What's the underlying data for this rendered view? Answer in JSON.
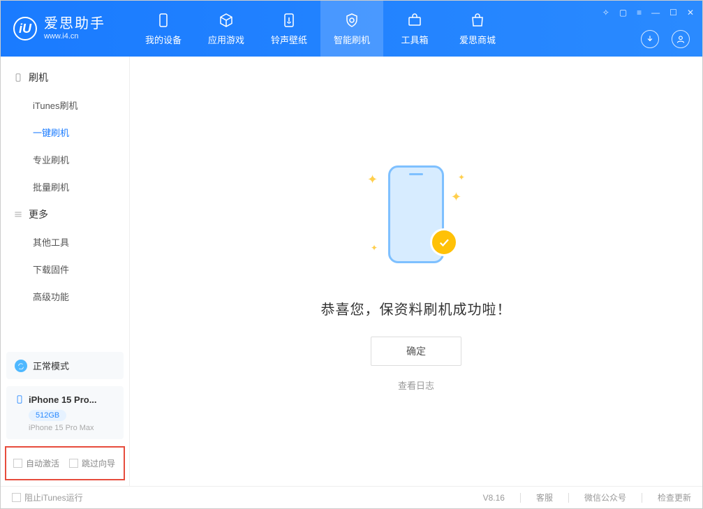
{
  "brand": {
    "title": "爱思助手",
    "subtitle": "www.i4.cn",
    "logo_letter": "iU"
  },
  "nav": {
    "items": [
      {
        "label": "我的设备"
      },
      {
        "label": "应用游戏"
      },
      {
        "label": "铃声壁纸"
      },
      {
        "label": "智能刷机"
      },
      {
        "label": "工具箱"
      },
      {
        "label": "爱思商城"
      }
    ],
    "active_index": 3
  },
  "sidebar": {
    "group_flash": "刷机",
    "items_flash": [
      {
        "label": "iTunes刷机"
      },
      {
        "label": "一键刷机"
      },
      {
        "label": "专业刷机"
      },
      {
        "label": "批量刷机"
      }
    ],
    "flash_active_index": 1,
    "group_more": "更多",
    "items_more": [
      {
        "label": "其他工具"
      },
      {
        "label": "下载固件"
      },
      {
        "label": "高级功能"
      }
    ]
  },
  "mode": {
    "label": "正常模式"
  },
  "device": {
    "name": "iPhone 15 Pro...",
    "storage": "512GB",
    "model": "iPhone 15 Pro Max"
  },
  "options": {
    "auto_activate": "自动激活",
    "skip_guide": "跳过向导"
  },
  "main": {
    "success_text": "恭喜您，保资料刷机成功啦！",
    "ok_button": "确定",
    "view_log": "查看日志"
  },
  "footer": {
    "block_itunes": "阻止iTunes运行",
    "version": "V8.16",
    "support": "客服",
    "wechat": "微信公众号",
    "check_update": "检查更新"
  }
}
